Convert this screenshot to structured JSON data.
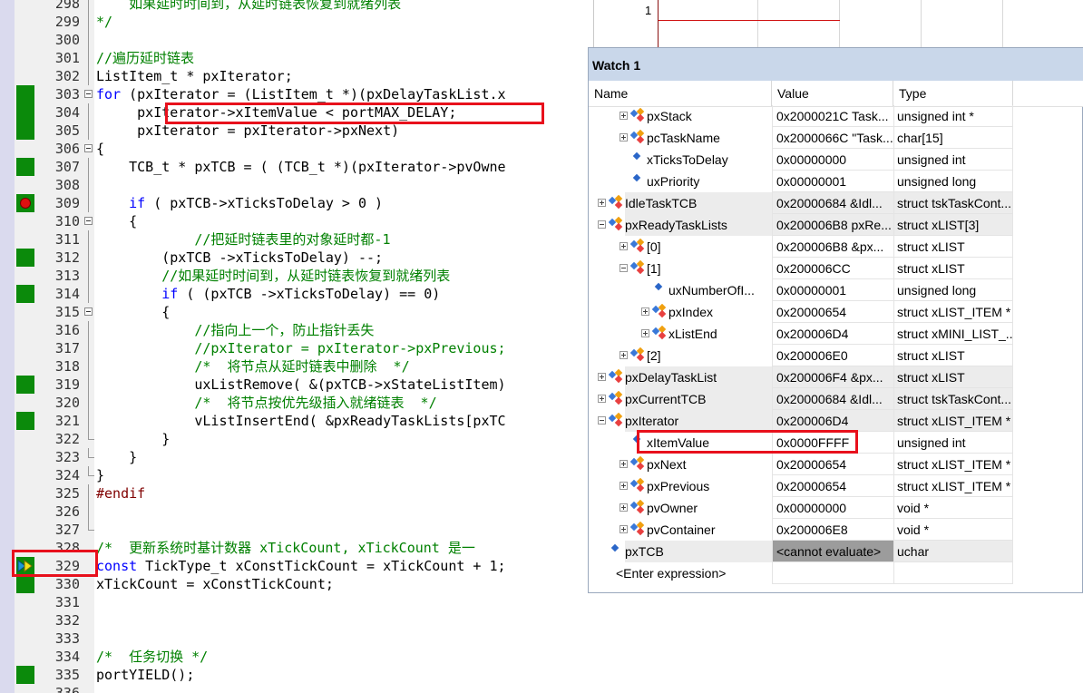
{
  "editor": {
    "lines": [
      {
        "n": "298",
        "text": "    如果延时时间到，从延时链表恢复到就绪列表",
        "cls": "cm",
        "cov": false,
        "fold": "line"
      },
      {
        "n": "299",
        "text": "*/",
        "cls": "cm",
        "cov": false,
        "fold": "line"
      },
      {
        "n": "300",
        "text": "",
        "cls": "",
        "cov": false,
        "fold": "line"
      },
      {
        "n": "301",
        "text": "//遍历延时链表",
        "cls": "cm",
        "cov": false,
        "fold": "line"
      },
      {
        "n": "302",
        "text": "ListItem_t * pxIterator;",
        "cls": "",
        "cov": false,
        "fold": "line"
      },
      {
        "n": "303",
        "text": "for (pxIterator = (ListItem_t *)(pxDelayTaskList.x",
        "cls": "",
        "kw": "for",
        "cov": true,
        "fold": "box"
      },
      {
        "n": "304",
        "text": "     pxIterator->xItemValue < portMAX_DELAY;",
        "cls": "",
        "cov": true,
        "fold": "line"
      },
      {
        "n": "305",
        "text": "     pxIterator = pxIterator->pxNext)",
        "cls": "",
        "cov": true,
        "fold": "line"
      },
      {
        "n": "306",
        "text": "{",
        "cls": "",
        "cov": false,
        "fold": "box"
      },
      {
        "n": "307",
        "text": "    TCB_t * pxTCB = ( (TCB_t *)(pxIterator->pvOwne",
        "cls": "",
        "cov": true,
        "fold": "line"
      },
      {
        "n": "308",
        "text": "",
        "cls": "",
        "cov": false,
        "fold": "line"
      },
      {
        "n": "309",
        "text": "    if ( pxTCB->xTicksToDelay > 0 )",
        "cls": "",
        "kw": "if",
        "num": "0",
        "cov": true,
        "bp": true,
        "fold": "line"
      },
      {
        "n": "310",
        "text": "    {",
        "cls": "",
        "cov": false,
        "fold": "box"
      },
      {
        "n": "311",
        "text": "            //把延时链表里的对象延时都-1",
        "cls": "cm",
        "cov": false,
        "fold": "line"
      },
      {
        "n": "312",
        "text": "        (pxTCB ->xTicksToDelay) --;",
        "cls": "",
        "cov": true,
        "fold": "line"
      },
      {
        "n": "313",
        "text": "        //如果延时时间到，从延时链表恢复到就绪列表",
        "cls": "cm",
        "cov": false,
        "fold": "line"
      },
      {
        "n": "314",
        "text": "        if ( (pxTCB ->xTicksToDelay) == 0)",
        "cls": "",
        "kw": "if",
        "num": "0",
        "cov": true,
        "fold": "line"
      },
      {
        "n": "315",
        "text": "        {",
        "cls": "",
        "cov": false,
        "fold": "box"
      },
      {
        "n": "316",
        "text": "            //指向上一个，防止指针丢失",
        "cls": "cm",
        "cov": false,
        "fold": "line"
      },
      {
        "n": "317",
        "text": "            //pxIterator = pxIterator->pxPrevious;",
        "cls": "cm",
        "cov": false,
        "fold": "line"
      },
      {
        "n": "318",
        "text": "            /*  将节点从延时链表中删除  */",
        "cls": "cm",
        "cov": false,
        "fold": "line"
      },
      {
        "n": "319",
        "text": "            uxListRemove( &(pxTCB->xStateListItem)",
        "cls": "",
        "cov": true,
        "fold": "line"
      },
      {
        "n": "320",
        "text": "            /*  将节点按优先级插入就绪链表  */",
        "cls": "cm",
        "cov": false,
        "fold": "line"
      },
      {
        "n": "321",
        "text": "            vListInsertEnd( &pxReadyTaskLists[pxTC",
        "cls": "",
        "cov": true,
        "fold": "line"
      },
      {
        "n": "322",
        "text": "        }",
        "cls": "",
        "cov": false,
        "fold": "end"
      },
      {
        "n": "323",
        "text": "    }",
        "cls": "",
        "cov": false,
        "fold": "end"
      },
      {
        "n": "324",
        "text": "}",
        "cls": "",
        "cov": false,
        "fold": "end"
      },
      {
        "n": "325",
        "text": "#endif",
        "cls": "pp",
        "cov": false,
        "fold": "line"
      },
      {
        "n": "326",
        "text": "",
        "cls": "",
        "cov": false,
        "fold": "line"
      },
      {
        "n": "327",
        "text": "",
        "cls": "",
        "cov": false,
        "fold": "end"
      },
      {
        "n": "328",
        "text": "/*  更新系统时基计数器 xTickCount, xTickCount 是一",
        "cls": "cm",
        "cov": false,
        "fold": ""
      },
      {
        "n": "329",
        "text": "const TickType_t xConstTickCount = xTickCount + 1;",
        "cls": "",
        "kw": "const",
        "num": "1",
        "cov": true,
        "arrow": true,
        "fold": ""
      },
      {
        "n": "330",
        "text": "xTickCount = xConstTickCount;",
        "cls": "",
        "cov": true,
        "fold": ""
      },
      {
        "n": "331",
        "text": "",
        "cls": "",
        "cov": false,
        "fold": ""
      },
      {
        "n": "332",
        "text": "",
        "cls": "",
        "cov": false,
        "fold": ""
      },
      {
        "n": "333",
        "text": "",
        "cls": "",
        "cov": false,
        "fold": ""
      },
      {
        "n": "334",
        "text": "/*  任务切换 */",
        "cls": "cm",
        "cov": false,
        "fold": ""
      },
      {
        "n": "335",
        "text": "portYIELD();",
        "cls": "",
        "cov": true,
        "fold": ""
      },
      {
        "n": "336",
        "text": "",
        "cls": "",
        "cov": false,
        "fold": ""
      }
    ]
  },
  "graph": {
    "y_label": "1"
  },
  "watch": {
    "title": "Watch 1",
    "headers": {
      "name": "Name",
      "value": "Value",
      "type": "Type"
    },
    "rows": [
      {
        "indent": 1,
        "exp": "plus",
        "icon": "struct",
        "name": "pxStack",
        "value": "0x2000021C Task...",
        "type": "unsigned int *",
        "shaded": false
      },
      {
        "indent": 1,
        "exp": "plus",
        "icon": "struct",
        "name": "pcTaskName",
        "value": "0x2000066C \"Task...",
        "type": "char[15]",
        "shaded": false
      },
      {
        "indent": 1,
        "exp": "",
        "icon": "var",
        "name": "xTicksToDelay",
        "value": "0x00000000",
        "type": "unsigned int",
        "shaded": false
      },
      {
        "indent": 1,
        "exp": "",
        "icon": "var",
        "name": "uxPriority",
        "value": "0x00000001",
        "type": "unsigned long",
        "shaded": false
      },
      {
        "indent": 0,
        "exp": "plus",
        "icon": "struct",
        "name": "IdleTaskTCB",
        "value": "0x20000684 &Idl...",
        "type": "struct tskTaskCont...",
        "shaded": true
      },
      {
        "indent": 0,
        "exp": "minus",
        "icon": "struct",
        "name": "pxReadyTaskLists",
        "value": "0x200006B8 pxRe...",
        "type": "struct xLIST[3]",
        "shaded": true
      },
      {
        "indent": 1,
        "exp": "plus",
        "icon": "struct",
        "name": "[0]",
        "value": "0x200006B8 &px...",
        "type": "struct xLIST",
        "shaded": false
      },
      {
        "indent": 1,
        "exp": "minus",
        "icon": "struct",
        "name": "[1]",
        "value": "0x200006CC",
        "type": "struct xLIST",
        "shaded": false
      },
      {
        "indent": 2,
        "exp": "",
        "icon": "var",
        "name": "uxNumberOfI...",
        "value": "0x00000001",
        "type": "unsigned long",
        "shaded": false
      },
      {
        "indent": 2,
        "exp": "plus",
        "icon": "struct",
        "name": "pxIndex",
        "value": "0x20000654",
        "type": "struct xLIST_ITEM *",
        "shaded": false
      },
      {
        "indent": 2,
        "exp": "plus",
        "icon": "struct",
        "name": "xListEnd",
        "value": "0x200006D4",
        "type": "struct xMINI_LIST_...",
        "shaded": false
      },
      {
        "indent": 1,
        "exp": "plus",
        "icon": "struct",
        "name": "[2]",
        "value": "0x200006E0",
        "type": "struct xLIST",
        "shaded": false
      },
      {
        "indent": 0,
        "exp": "plus",
        "icon": "struct",
        "name": "pxDelayTaskList",
        "value": "0x200006F4 &px...",
        "type": "struct xLIST",
        "shaded": true
      },
      {
        "indent": 0,
        "exp": "plus",
        "icon": "struct",
        "name": "pxCurrentTCB",
        "value": "0x20000684 &Idl...",
        "type": "struct tskTaskCont...",
        "shaded": true
      },
      {
        "indent": 0,
        "exp": "minus",
        "icon": "struct",
        "name": "pxIterator",
        "value": "0x200006D4",
        "type": "struct xLIST_ITEM *",
        "shaded": true
      },
      {
        "indent": 1,
        "exp": "",
        "icon": "var",
        "name": "xItemValue",
        "value": "0x0000FFFF",
        "type": "unsigned int",
        "shaded": false
      },
      {
        "indent": 1,
        "exp": "plus",
        "icon": "struct",
        "name": "pxNext",
        "value": "0x20000654",
        "type": "struct xLIST_ITEM *",
        "shaded": false
      },
      {
        "indent": 1,
        "exp": "plus",
        "icon": "struct",
        "name": "pxPrevious",
        "value": "0x20000654",
        "type": "struct xLIST_ITEM *",
        "shaded": false
      },
      {
        "indent": 1,
        "exp": "plus",
        "icon": "struct",
        "name": "pvOwner",
        "value": "0x00000000",
        "type": "void *",
        "shaded": false
      },
      {
        "indent": 1,
        "exp": "plus",
        "icon": "struct",
        "name": "pvContainer",
        "value": "0x200006E8",
        "type": "void *",
        "shaded": false
      },
      {
        "indent": 0,
        "exp": "",
        "icon": "var",
        "name": "pxTCB",
        "value": "<cannot evaluate>",
        "type": "uchar",
        "shaded": true,
        "err": true
      }
    ],
    "enter_expression": "<Enter expression>"
  },
  "colors": {
    "coverage": "#0b8a0b",
    "highlight": "#e8101c",
    "breakpoint": "#e01010"
  }
}
